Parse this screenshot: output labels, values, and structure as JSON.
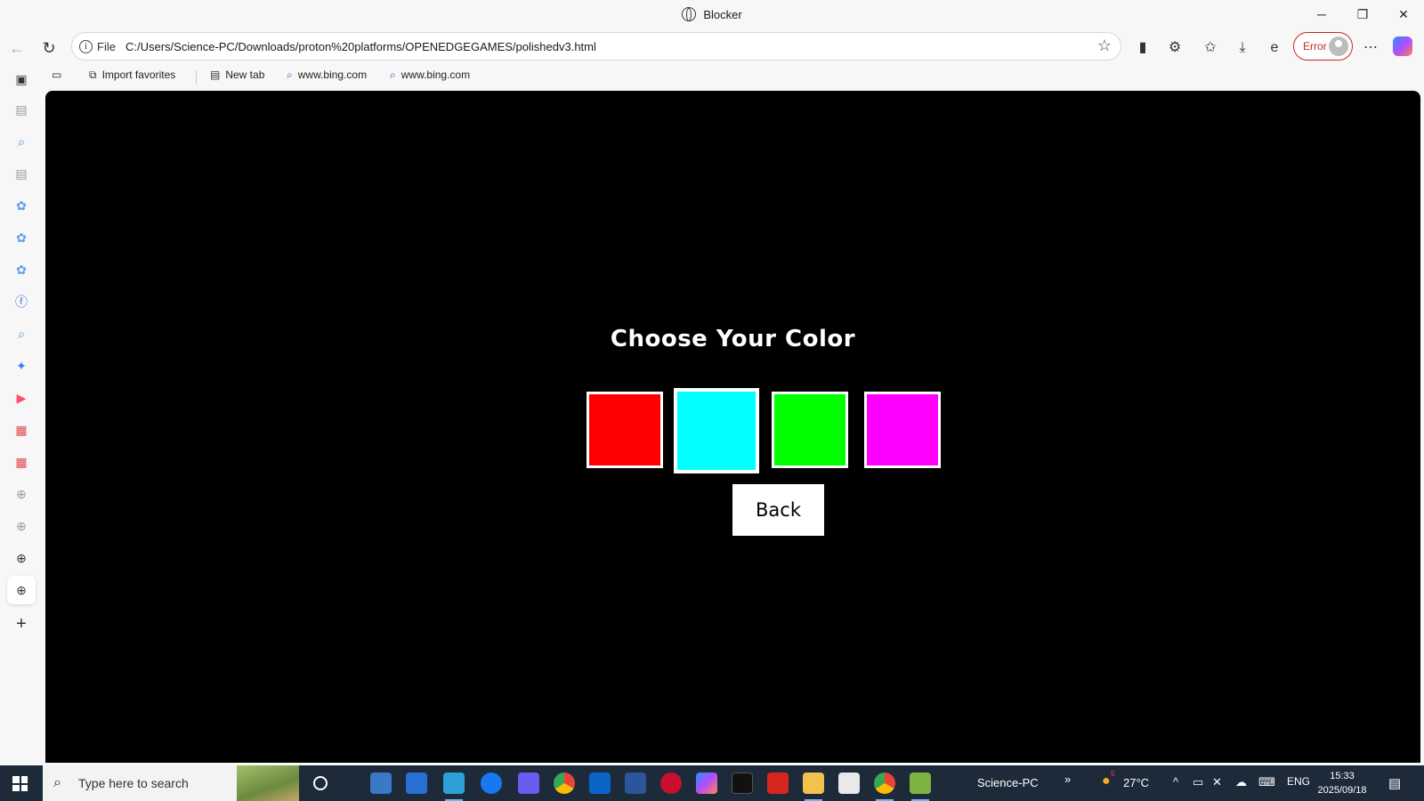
{
  "window": {
    "title": "Blocker",
    "minimize_glyph": "─",
    "restore_glyph": "❐",
    "close_glyph": "✕"
  },
  "nav": {
    "back_glyph": "←",
    "reload_glyph": "↻",
    "scheme": "File",
    "url": "C:/Users/Science-PC/Downloads/proton%20platforms/OPENEDGEGAMES/polishedv3.html",
    "profile_status": "Error"
  },
  "favorites": [
    {
      "label": "Import favorites",
      "icon": "import-icon"
    },
    {
      "label": "New tab",
      "icon": "newtab-icon"
    },
    {
      "label": "www.bing.com",
      "icon": "search-icon"
    },
    {
      "label": "www.bing.com",
      "icon": "search-icon"
    }
  ],
  "game": {
    "heading": "Choose Your Color",
    "colors": [
      {
        "name": "red",
        "hex": "#ff0000",
        "selected": false
      },
      {
        "name": "cyan",
        "hex": "#00ffff",
        "selected": true
      },
      {
        "name": "green",
        "hex": "#00ff00",
        "selected": false
      },
      {
        "name": "magenta",
        "hex": "#ff00ff",
        "selected": false
      }
    ],
    "back_label": "Back"
  },
  "taskbar": {
    "search_placeholder": "Type here to search",
    "user_label": "Science-PC",
    "weather": "27°C",
    "weather_badge": "5",
    "language": "ENG",
    "time": "15:33",
    "date": "2025/09/18"
  },
  "colors": {
    "page_bg": "#000000",
    "chrome_bg": "#f7f7f7",
    "error_red": "#c42b1c",
    "taskbar_bg": "#1c2a3a"
  }
}
